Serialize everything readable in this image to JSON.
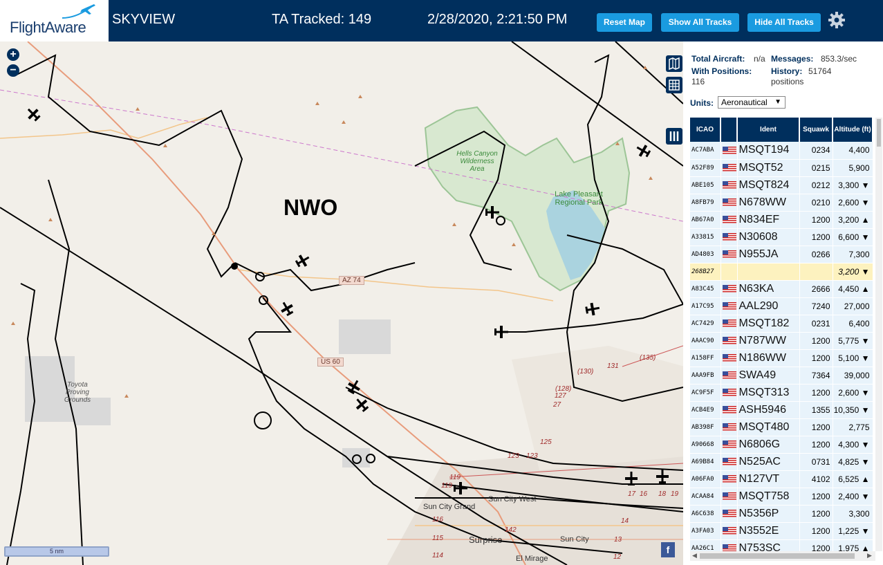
{
  "header": {
    "brand": "FlightAware",
    "app_title": "SKYVIEW",
    "tracked": "TA Tracked: 149",
    "datetime": "2/28/2020, 2:21:50 PM",
    "buttons": {
      "reset": "Reset Map",
      "show_all": "Show All Tracks",
      "hide_all": "Hide All Tracks"
    },
    "settings_icon": "gear-icon"
  },
  "map": {
    "area_label": "NWO",
    "zoom_in": "+",
    "zoom_out": "−",
    "scale": "5 nm",
    "roads": {
      "az74": "AZ 74",
      "us60": "US 60"
    },
    "places": {
      "hells_canyon": "Hells Canyon Wilderness Area",
      "lake_pleasant": "Lake Pleasant Regional Park",
      "toyota": "Toyota Proving Grounds",
      "sun_city_west": "Sun City West",
      "sun_city_grand": "Sun City Grand",
      "surprise": "Surprise",
      "sun_city": "Sun City",
      "el_mirage": "El Mirage"
    },
    "route_numbers": [
      "(135)",
      "131",
      "(130)",
      "(128)",
      "127",
      "27",
      "125",
      "123",
      "123",
      "119",
      "119",
      "116",
      "115",
      "114",
      "142",
      "14",
      "13",
      "12",
      "17",
      "16",
      "18",
      "19"
    ],
    "facebook": "f"
  },
  "stats": {
    "total_aircraft_label": "Total Aircraft:",
    "total_aircraft_value": "n/a",
    "messages_label": "Messages:",
    "messages_value": "853.3/sec",
    "with_positions_label": "With Positions:",
    "with_positions_value": "116",
    "history_label": "History:",
    "history_value": "51764",
    "history_unit": "positions",
    "units_label": "Units:",
    "units_value": "Aeronautical"
  },
  "table": {
    "headers": [
      "ICAO",
      "",
      "Ident",
      "Squawk",
      "Altitude (ft)"
    ],
    "rows": [
      {
        "icao": "AC7ABA",
        "ident": "MSQT194",
        "squawk": "0234",
        "alt": "4,400",
        "flag": true
      },
      {
        "icao": "A52F89",
        "ident": "MSQT52",
        "squawk": "0215",
        "alt": "5,900",
        "flag": true
      },
      {
        "icao": "ABE105",
        "ident": "MSQT824",
        "squawk": "0212",
        "alt": "3,300 ▼",
        "flag": true
      },
      {
        "icao": "A8FB79",
        "ident": "N678WW",
        "squawk": "0210",
        "alt": "2,600 ▼",
        "flag": true
      },
      {
        "icao": "AB67A0",
        "ident": "N834EF",
        "squawk": "1200",
        "alt": "3,200 ▲",
        "flag": true
      },
      {
        "icao": "A33815",
        "ident": "N30608",
        "squawk": "1200",
        "alt": "6,600 ▼",
        "flag": true
      },
      {
        "icao": "AD4803",
        "ident": "N955JA",
        "squawk": "0266",
        "alt": "7,300",
        "flag": true
      },
      {
        "icao": "268B27",
        "ident": "",
        "squawk": "",
        "alt": "3,200 ▼",
        "flag": false,
        "selected": true
      },
      {
        "icao": "A83C45",
        "ident": "N63KA",
        "squawk": "2666",
        "alt": "4,450 ▲",
        "flag": true
      },
      {
        "icao": "A17C95",
        "ident": "AAL290",
        "squawk": "7240",
        "alt": "27,000",
        "flag": true
      },
      {
        "icao": "AC7429",
        "ident": "MSQT182",
        "squawk": "0231",
        "alt": "6,400",
        "flag": true
      },
      {
        "icao": "AAAC90",
        "ident": "N787WW",
        "squawk": "1200",
        "alt": "5,775 ▼",
        "flag": true
      },
      {
        "icao": "A158FF",
        "ident": "N186WW",
        "squawk": "1200",
        "alt": "5,100 ▼",
        "flag": true
      },
      {
        "icao": "AAA9FB",
        "ident": "SWA49",
        "squawk": "7364",
        "alt": "39,000",
        "flag": true
      },
      {
        "icao": "AC9F5F",
        "ident": "MSQT313",
        "squawk": "1200",
        "alt": "2,600 ▼",
        "flag": true
      },
      {
        "icao": "ACB4E9",
        "ident": "ASH5946",
        "squawk": "1355",
        "alt": "10,350 ▼",
        "flag": true
      },
      {
        "icao": "AB398F",
        "ident": "MSQT480",
        "squawk": "1200",
        "alt": "2,775",
        "flag": true
      },
      {
        "icao": "A90668",
        "ident": "N6806G",
        "squawk": "1200",
        "alt": "4,300 ▼",
        "flag": true
      },
      {
        "icao": "A69B84",
        "ident": "N525AC",
        "squawk": "0731",
        "alt": "4,825 ▼",
        "flag": true
      },
      {
        "icao": "A06FA0",
        "ident": "N127VT",
        "squawk": "4102",
        "alt": "6,525 ▲",
        "flag": true
      },
      {
        "icao": "ACAA84",
        "ident": "MSQT758",
        "squawk": "1200",
        "alt": "2,400 ▼",
        "flag": true
      },
      {
        "icao": "A6C638",
        "ident": "N5356P",
        "squawk": "1200",
        "alt": "3,300",
        "flag": true
      },
      {
        "icao": "A3FA03",
        "ident": "N3552E",
        "squawk": "1200",
        "alt": "1,225 ▼",
        "flag": true
      },
      {
        "icao": "AA26C1",
        "ident": "N753SC",
        "squawk": "1200",
        "alt": "1,975 ▲",
        "flag": true
      }
    ]
  },
  "colors": {
    "header_bg": "#002f5d",
    "button_bg": "#1a9be0",
    "row_bg": "#e8f3fb",
    "selected_row": "#fdf2bf"
  }
}
